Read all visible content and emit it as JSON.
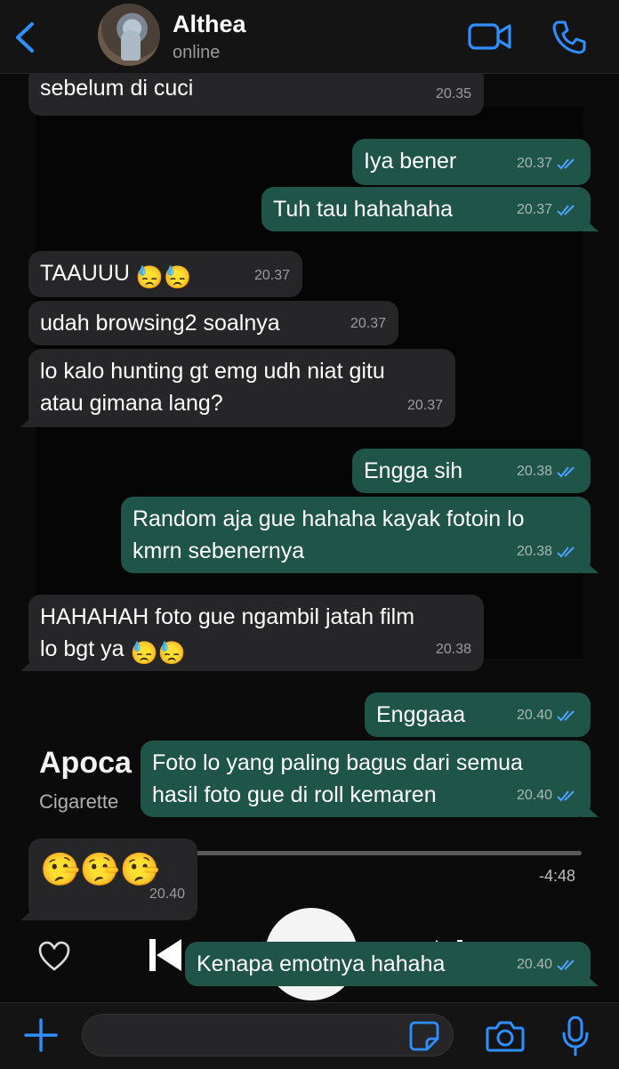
{
  "header": {
    "contact_name": "Althea",
    "status": "online",
    "icons": [
      "chevron-left-icon",
      "video-call-icon",
      "phone-icon"
    ]
  },
  "colors": {
    "accent": "#2f8fff",
    "incoming_bubble": "#262628",
    "outgoing_bubble": "#1f5448",
    "read_ticks": "#4fa3ff"
  },
  "background_card": {
    "title_partial": "Apoca",
    "artist_partial": "Cigarette",
    "time_remaining": "-4:48"
  },
  "messages": [
    {
      "dir": "in",
      "text": "sebelum di cuci",
      "time": "20.35"
    },
    {
      "dir": "out",
      "text": "Iya bener",
      "time": "20.37",
      "read": true
    },
    {
      "dir": "out",
      "text": "Tuh tau hahahaha",
      "time": "20.37",
      "read": true
    },
    {
      "dir": "in",
      "text": "TAAUUU",
      "emoji": "😓😓",
      "time": "20.37"
    },
    {
      "dir": "in",
      "text": "udah browsing2 soalnya",
      "time": "20.37"
    },
    {
      "dir": "in",
      "line1": "lo kalo hunting gt emg udh niat gitu",
      "line2": "atau gimana lang?",
      "time": "20.37"
    },
    {
      "dir": "out",
      "text": "Engga sih",
      "time": "20.38",
      "read": true
    },
    {
      "dir": "out",
      "line1": "Random aja gue hahaha kayak fotoin lo",
      "line2": "kmrn sebenernya",
      "time": "20.38",
      "read": true
    },
    {
      "dir": "in",
      "line1": "HAHAHAH foto gue ngambil jatah film",
      "line2": "lo bgt ya",
      "emoji": "😓😓",
      "time": "20.38"
    },
    {
      "dir": "out",
      "text": "Enggaaa",
      "time": "20.40",
      "read": true
    },
    {
      "dir": "out",
      "line1": "Foto lo yang paling bagus dari semua",
      "line2": "hasil foto gue di roll kemaren",
      "time": "20.40",
      "read": true
    },
    {
      "dir": "in",
      "emoji": "🤥🤥🤥",
      "time": "20.40"
    },
    {
      "dir": "out",
      "text": "Kenapa emotnya hahaha",
      "time": "20.40",
      "read": true
    }
  ],
  "composer": {
    "value": "",
    "icons": [
      "plus-icon",
      "sticker-icon",
      "camera-icon",
      "microphone-icon"
    ]
  }
}
